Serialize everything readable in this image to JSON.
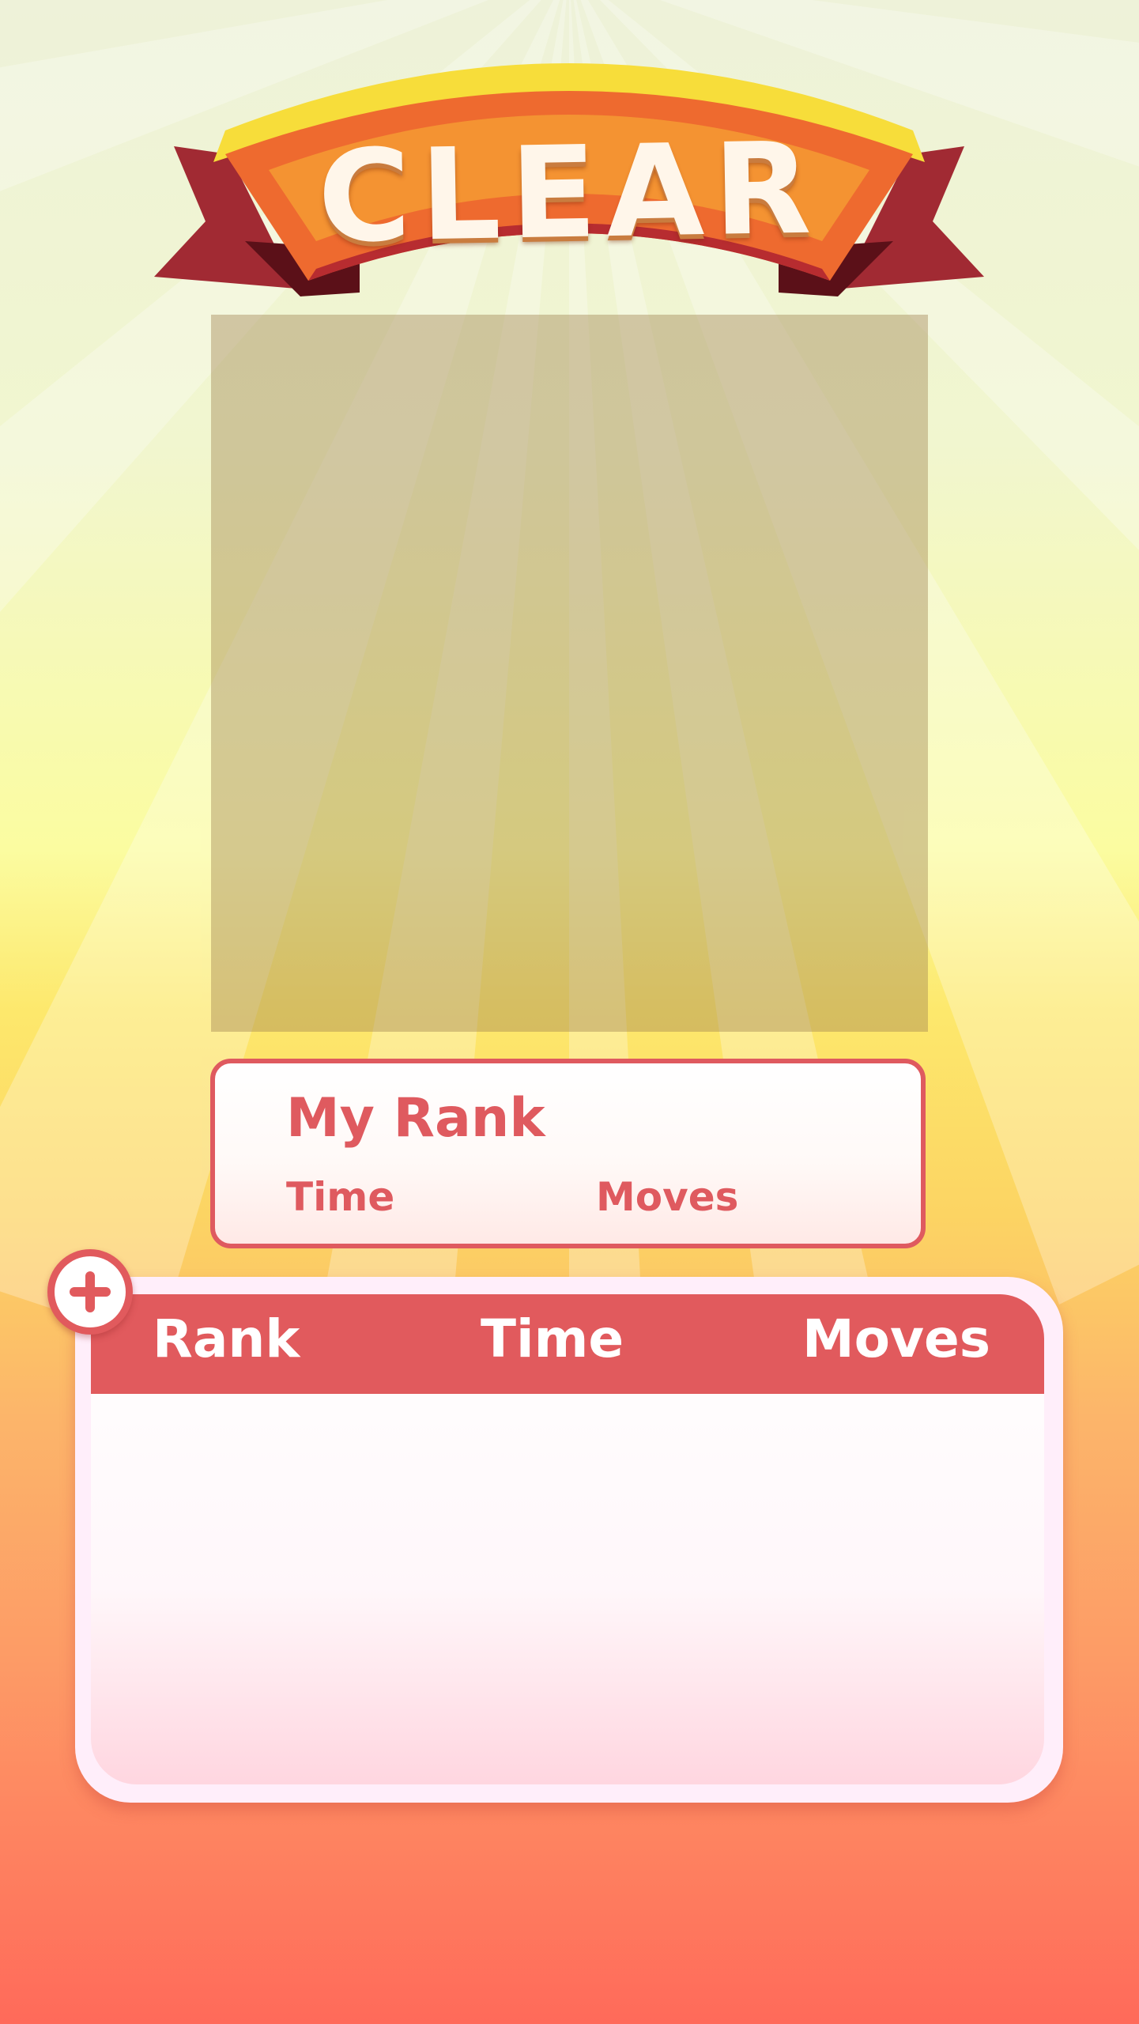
{
  "banner": {
    "title": "CLEAR"
  },
  "my_rank": {
    "title": "My Rank",
    "time_label": "Time",
    "moves_label": "Moves"
  },
  "leaderboard": {
    "columns": [
      "Rank",
      "Time",
      "Moves"
    ],
    "rows": []
  },
  "icons": {
    "expand": "plus-icon"
  },
  "colors": {
    "accent_red": "#e15a5d",
    "banner_orange": "#f08a2c",
    "ribbon_dark": "#9c2530"
  }
}
